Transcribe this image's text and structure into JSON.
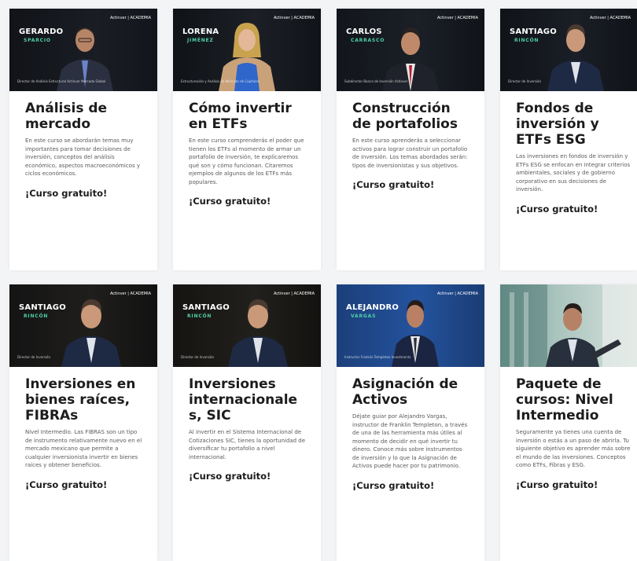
{
  "brand_label": "Actinver | ACADEMIA",
  "cards": [
    {
      "name_first": "GERARDO",
      "name_last": "SPARCIO",
      "caption": "Director de Análisis Estructural Actinver Mercado Global",
      "title": "Análisis de mercado",
      "desc": "En este curso se abordarán temas muy importantes para tomar decisiones de inversión, conceptos del análisis económico, aspectos macroeconómicos y ciclos económicos.",
      "cta": "¡Curso gratuito!"
    },
    {
      "name_first": "LORENA",
      "name_last": "JIMÉNEZ",
      "caption": "Estructuración y Análisis de Mercado de Capitales",
      "title": "Cómo invertir en ETFs",
      "desc": "En este curso comprenderás el poder que tienen los ETFs al momento de armar un portafolio de inversión, te explicaremos qué son y cómo funcionan. Citaremos ejemplos de algunos de los ETFs más populares.",
      "cta": "¡Curso gratuito!"
    },
    {
      "name_first": "CARLOS",
      "name_last": "CARRASCO",
      "caption": "Subdirector Banca de Inversión Actinver",
      "title": "Construcción de portafolios",
      "desc": "En este curso aprenderás a seleccionar activos para lograr construir un portafolio de inversión. Los temas abordados serán: tipos de inversionistas y sus objetivos.",
      "cta": "¡Curso gratuito!"
    },
    {
      "name_first": "SANTIAGO",
      "name_last": "RINCÓN",
      "caption": "Director de Inversión",
      "title": "Fondos de inversión y ETFs ESG",
      "desc": "Las inversiones en fondos de inversión y ETFs ESG se enfocan en integrar criterios ambientales, sociales y de gobierno corporativo en sus decisiones de inversión.",
      "cta": "¡Curso gratuito!"
    },
    {
      "name_first": "SANTIAGO",
      "name_last": "RINCÓN",
      "caption": "Director de Inversión",
      "title": "Inversiones en bienes raíces, FIBRAs",
      "desc": "Nivel Intermedio.  Las FIBRAS son un tipo de instrumento relativamente nuevo en el mercado mexicano que permite a cualquier inversionista invertir en bienes raíces y obtener beneficios.",
      "cta": "¡Curso gratuito!"
    },
    {
      "name_first": "SANTIAGO",
      "name_last": "RINCÓN",
      "caption": "Director de Inversión",
      "title": "Inversiones internacionale s, SIC",
      "desc": "Al invertir en el Sistema Internacional de Cotizaciones SIC, tienes la oportunidad de diversificar tu portafolio a nivel internacional.",
      "cta": "¡Curso gratuito!"
    },
    {
      "name_first": "ALEJANDRO",
      "name_last": "VARGAS",
      "caption": "Instructor Franklin Templeton Investments",
      "title": "Asignación de Activos",
      "desc": "Déjate guiar por Alejandro Vargas, instructor de Franklin Templeton, a través de una de las herramienta más útiles al momento de decidir en qué invertir tu dinero. Conoce más sobre instrumentos de inversión y lo que la Asignación de Activos puede hacer por tu patrimonio.",
      "cta": "¡Curso gratuito!"
    },
    {
      "name_first": "",
      "name_last": "",
      "caption": "",
      "title": "Paquete de cursos: Nivel Intermedio",
      "desc": "Seguramente ya tienes una cuenta de inversión o estás a un paso de abrirla. Tu siguiente objetivo es aprender más sobre el mundo de las inversiones. Conceptos como ETFs, Fibras y ESG.",
      "cta": "¡Curso gratuito!"
    }
  ]
}
